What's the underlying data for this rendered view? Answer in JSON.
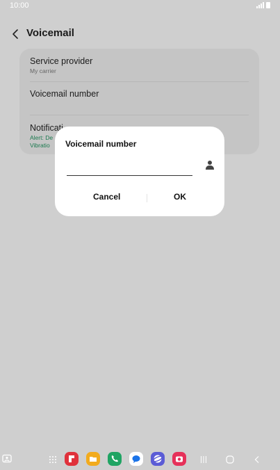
{
  "status": {
    "time": "10:00"
  },
  "header": {
    "title": "Voicemail",
    "back_icon": "chevron-left-icon"
  },
  "settings": {
    "service_provider": {
      "label": "Service provider",
      "value": "My carrier"
    },
    "voicemail_number": {
      "label": "Voicemail number"
    },
    "notifications": {
      "label": "Notificati",
      "line1": "Alert: De",
      "line2": "Vibratio"
    }
  },
  "dialog": {
    "title": "Voicemail number",
    "input_value": "",
    "contact_icon": "person-icon",
    "cancel_label": "Cancel",
    "ok_label": "OK"
  },
  "dock": {
    "apps": [
      {
        "name": "flipboard",
        "color": "#e0323c"
      },
      {
        "name": "my-files",
        "color": "#f2ab1d"
      },
      {
        "name": "phone",
        "color": "#1fa463"
      },
      {
        "name": "messages",
        "color": "#ffffff"
      },
      {
        "name": "internet",
        "color": "#5b5cd6"
      },
      {
        "name": "camera",
        "color": "#e6315a"
      }
    ]
  }
}
